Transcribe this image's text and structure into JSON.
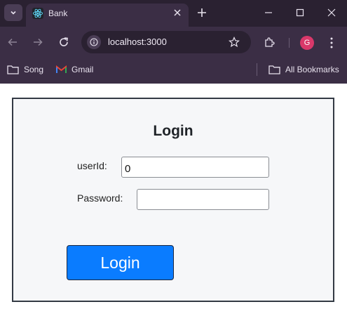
{
  "browser": {
    "tab": {
      "title": "Bank",
      "favicon": "react-logo-icon"
    },
    "address_bar": {
      "url": "localhost:3000"
    },
    "profile_initial": "G",
    "bookmarks": [
      {
        "label": "Song",
        "icon": "folder-icon"
      },
      {
        "label": "Gmail",
        "icon": "gmail-icon"
      }
    ],
    "all_bookmarks_label": "All Bookmarks",
    "colors": {
      "frame": "#2a2131",
      "toolbar": "#3b2e45",
      "profile": "#d9386a"
    }
  },
  "login": {
    "title": "Login",
    "userid_label": "userId:",
    "userid_value": "0",
    "password_label": "Password:",
    "password_value": "",
    "button_label": "Login",
    "colors": {
      "button": "#0a7cff",
      "panel": "#f6f7f9",
      "border": "#333a44"
    }
  }
}
